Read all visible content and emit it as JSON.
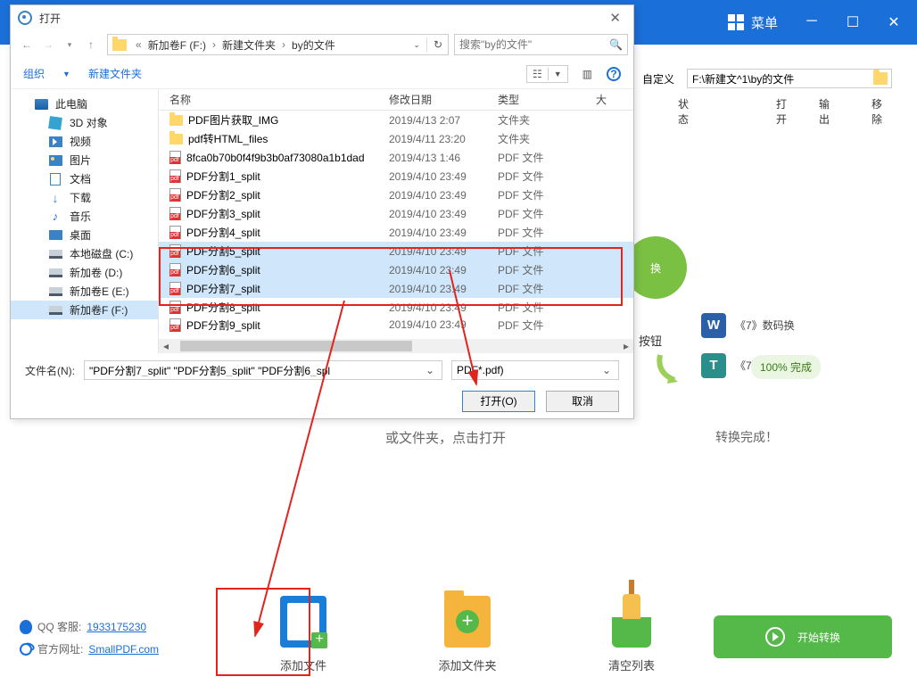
{
  "app": {
    "menu_label": "菜单",
    "custom_label": "自定义",
    "path_display": "F:\\新建文^1\\by的文件",
    "headers": {
      "state": "状态",
      "open": "打开",
      "output": "输出",
      "remove": "移除"
    },
    "convert_btn": "换",
    "button_tip": "按钮",
    "result_doc1": "《7》数码换",
    "result_doc2": "《7》",
    "progress_text": "100%  完成",
    "convert_done": "转换完成！",
    "hint_line": "或文件夹，点击打开",
    "action_addfile": "添加文件",
    "action_addfolder": "添加文件夹",
    "action_clear": "清空列表",
    "start_btn": "开始转换",
    "footer_qq_label": "QQ 客服:",
    "footer_qq_value": "1933175230",
    "footer_site_label": "官方网址:",
    "footer_site_value": "SmallPDF.com"
  },
  "dialog": {
    "title": "打开",
    "breadcrumb": [
      "新加卷F (F:)",
      "新建文件夹",
      "by的文件"
    ],
    "search_placeholder": "搜索\"by的文件\"",
    "toolbar_org": "组织",
    "toolbar_newfolder": "新建文件夹",
    "headers": {
      "name": "名称",
      "date": "修改日期",
      "type": "类型",
      "size": "大"
    },
    "tree": [
      {
        "label": "此电脑",
        "icon": "pc"
      },
      {
        "label": "3D 对象",
        "icon": "3d",
        "sub": true
      },
      {
        "label": "视频",
        "icon": "video",
        "sub": true
      },
      {
        "label": "图片",
        "icon": "pic",
        "sub": true
      },
      {
        "label": "文档",
        "icon": "doc",
        "sub": true
      },
      {
        "label": "下载",
        "icon": "down",
        "sub": true
      },
      {
        "label": "音乐",
        "icon": "music",
        "sub": true
      },
      {
        "label": "桌面",
        "icon": "desk",
        "sub": true
      },
      {
        "label": "本地磁盘 (C:)",
        "icon": "disk",
        "sub": true
      },
      {
        "label": "新加卷 (D:)",
        "icon": "disk",
        "sub": true
      },
      {
        "label": "新加卷E (E:)",
        "icon": "disk",
        "sub": true
      },
      {
        "label": "新加卷F (F:)",
        "icon": "disk",
        "sub": true,
        "selected": true
      }
    ],
    "files": [
      {
        "name": "PDF图片获取_IMG",
        "date": "2019/4/13 2:07",
        "type": "文件夹",
        "icon": "folder"
      },
      {
        "name": "pdf转HTML_files",
        "date": "2019/4/11 23:20",
        "type": "文件夹",
        "icon": "folder"
      },
      {
        "name": "8fca0b70b0f4f9b3b0af73080a1b1dad",
        "date": "2019/4/13 1:46",
        "type": "PDF 文件",
        "icon": "pdf"
      },
      {
        "name": "PDF分割1_split",
        "date": "2019/4/10 23:49",
        "type": "PDF 文件",
        "icon": "pdf"
      },
      {
        "name": "PDF分割2_split",
        "date": "2019/4/10 23:49",
        "type": "PDF 文件",
        "icon": "pdf"
      },
      {
        "name": "PDF分割3_split",
        "date": "2019/4/10 23:49",
        "type": "PDF 文件",
        "icon": "pdf"
      },
      {
        "name": "PDF分割4_split",
        "date": "2019/4/10 23:49",
        "type": "PDF 文件",
        "icon": "pdf"
      },
      {
        "name": "PDF分割5_split",
        "date": "2019/4/10 23:49",
        "type": "PDF 文件",
        "icon": "pdf",
        "selected": true
      },
      {
        "name": "PDF分割6_split",
        "date": "2019/4/10 23:49",
        "type": "PDF 文件",
        "icon": "pdf",
        "selected": true
      },
      {
        "name": "PDF分割7_split",
        "date": "2019/4/10 23:49",
        "type": "PDF 文件",
        "icon": "pdf",
        "selected": true
      },
      {
        "name": "PDF分割8_split",
        "date": "2019/4/10 23:49",
        "type": "PDF 文件",
        "icon": "pdf"
      },
      {
        "name": "PDF分割9_split",
        "date": "2019/4/10 23:49",
        "type": "PDF 文件",
        "icon": "pdf",
        "cut": true
      }
    ],
    "filename_label": "文件名(N):",
    "filename_value": "\"PDF分割7_split\" \"PDF分割5_split\" \"PDF分割6_spl",
    "filter_value": "PDF*.pdf)",
    "btn_open": "打开(O)",
    "btn_cancel": "取消"
  }
}
